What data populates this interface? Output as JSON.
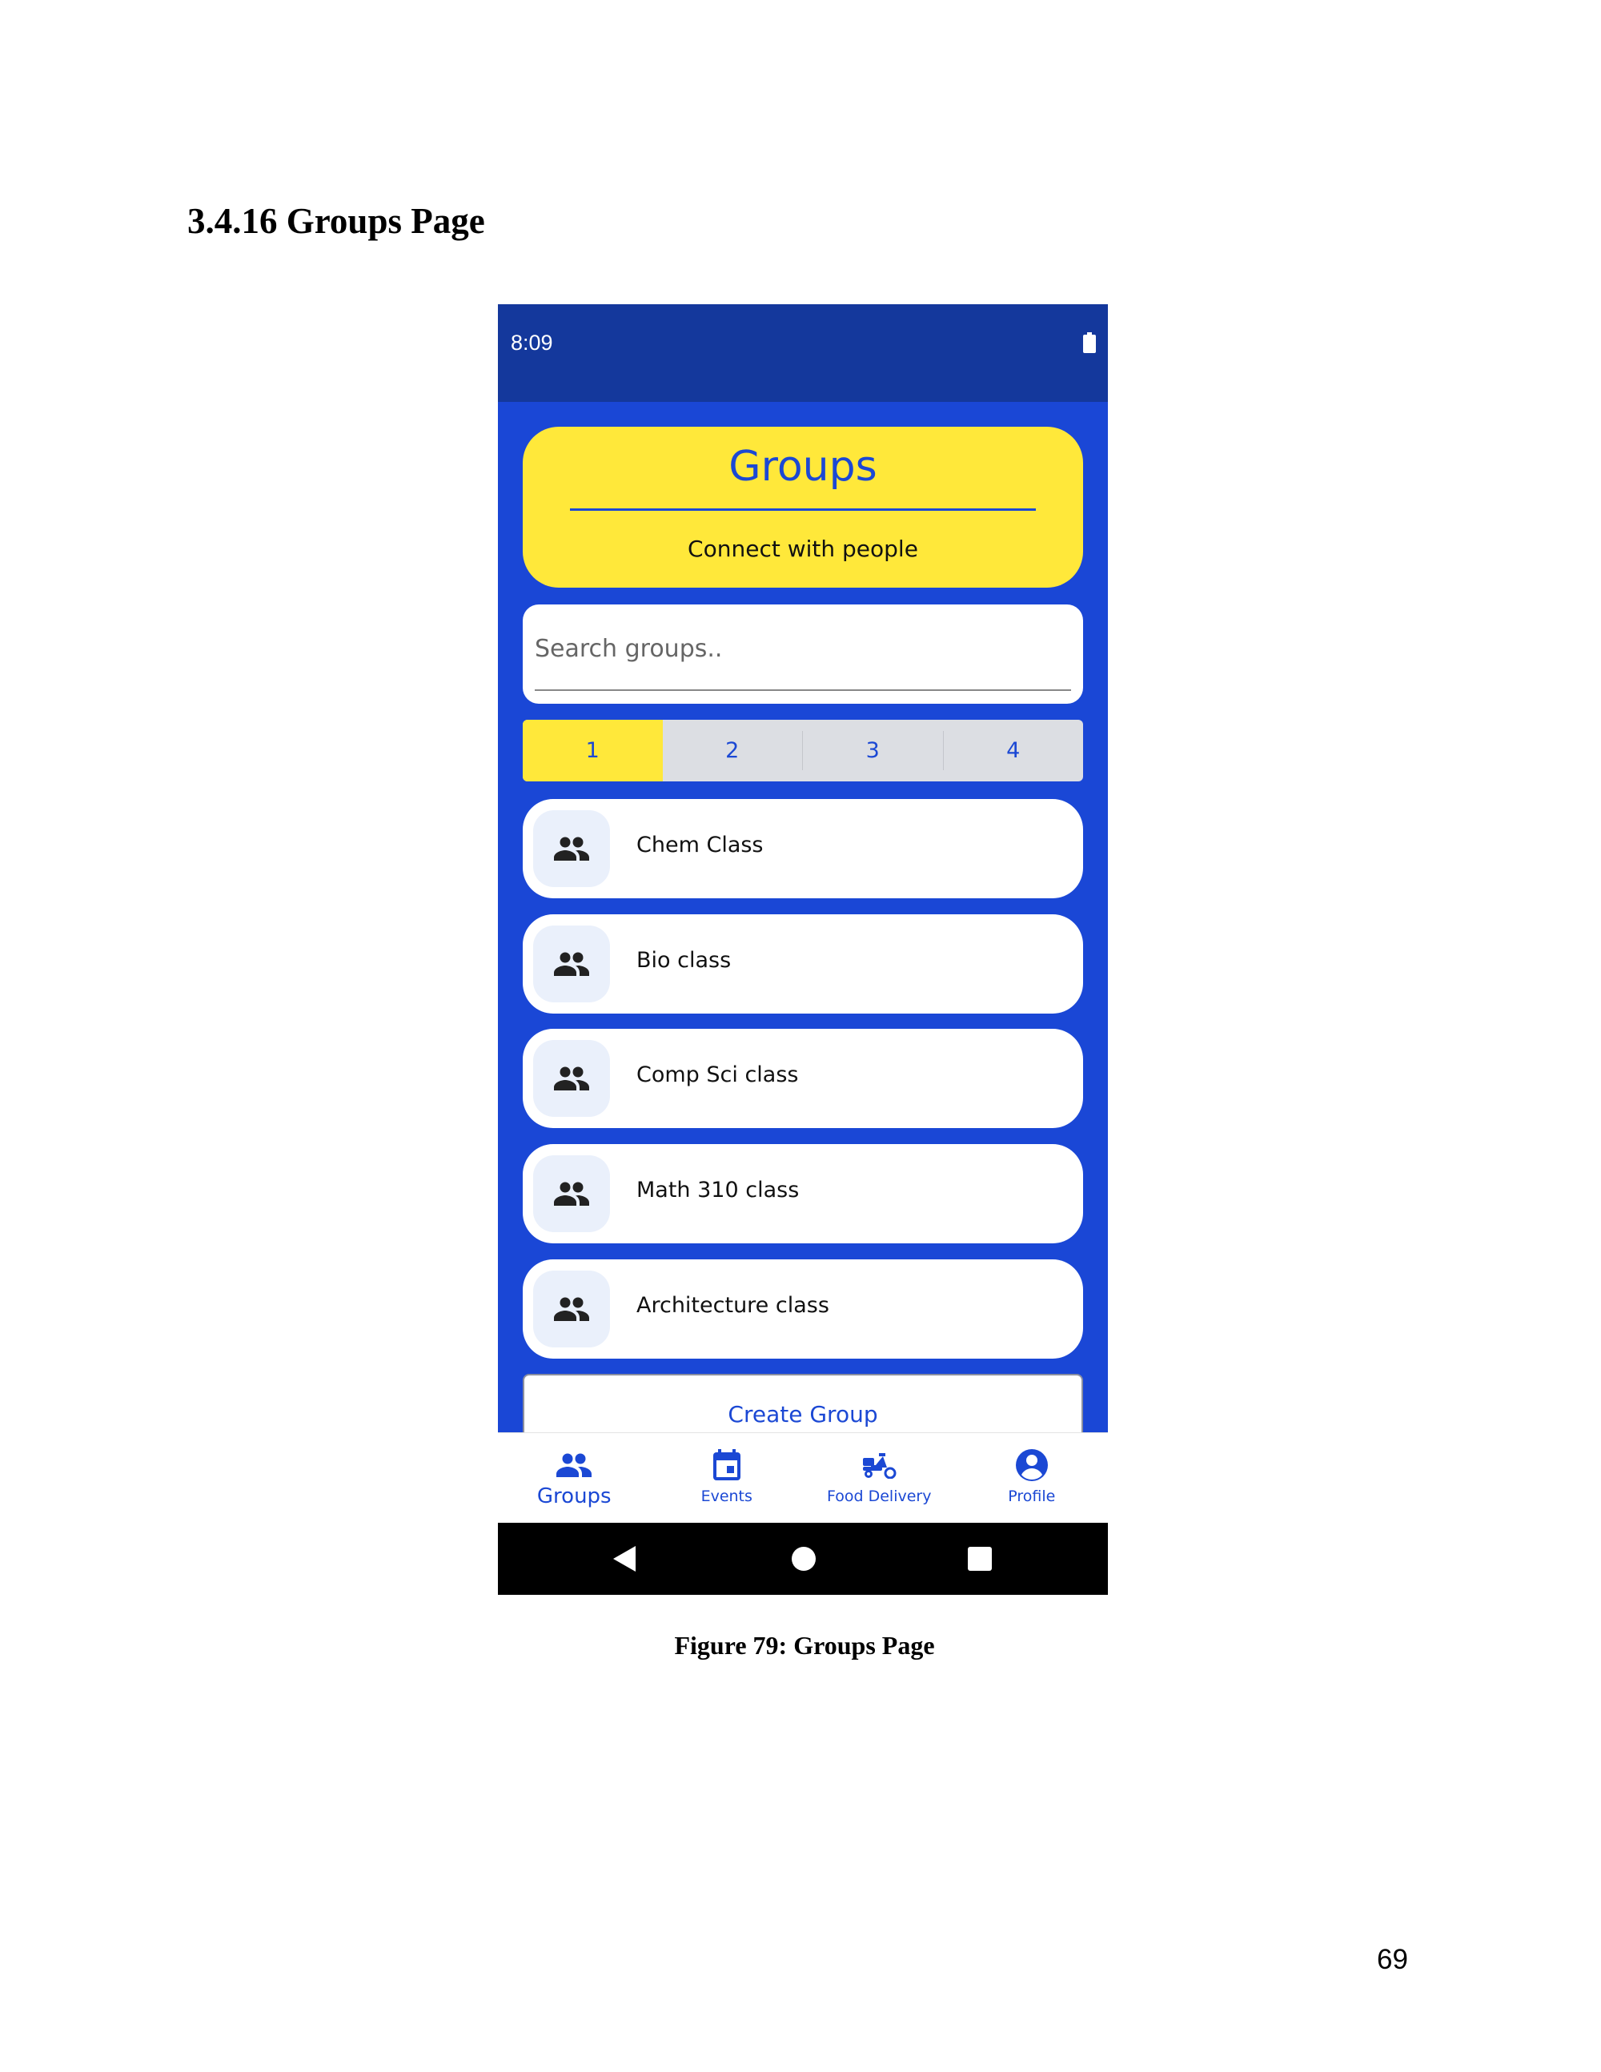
{
  "document": {
    "section_heading": "3.4.16 Groups Page",
    "figure_caption": "Figure 79: Groups Page",
    "page_number": "69"
  },
  "phone": {
    "status_bar": {
      "time": "8:09",
      "battery_icon": "battery-full-icon"
    },
    "header": {
      "title": "Groups",
      "subtitle": "Connect with people"
    },
    "search": {
      "placeholder": "Search groups.."
    },
    "tabs": [
      {
        "label": "1",
        "active": true
      },
      {
        "label": "2",
        "active": false
      },
      {
        "label": "3",
        "active": false
      },
      {
        "label": "4",
        "active": false
      }
    ],
    "groups": [
      {
        "name": "Chem Class",
        "icon": "people-icon"
      },
      {
        "name": "Bio class",
        "icon": "people-icon"
      },
      {
        "name": "Comp Sci class",
        "icon": "people-icon"
      },
      {
        "name": "Math 310 class",
        "icon": "people-icon"
      },
      {
        "name": "Architecture class",
        "icon": "people-icon"
      }
    ],
    "create_button": {
      "label": "Create Group"
    },
    "bottom_nav": [
      {
        "label": "Groups",
        "icon": "people-icon",
        "active": true
      },
      {
        "label": "Events",
        "icon": "calendar-icon",
        "active": false
      },
      {
        "label": "Food Delivery",
        "icon": "scooter-icon",
        "active": false
      },
      {
        "label": "Profile",
        "icon": "account-circle-icon",
        "active": false
      }
    ],
    "android_nav": {
      "back_icon": "back-triangle-icon",
      "home_icon": "home-circle-icon",
      "recents_icon": "recents-square-icon"
    }
  },
  "colors": {
    "brand_blue": "#1a47d6",
    "status_bar_blue": "#14389c",
    "accent_yellow": "#ffe83a",
    "card_white": "#ffffff"
  }
}
